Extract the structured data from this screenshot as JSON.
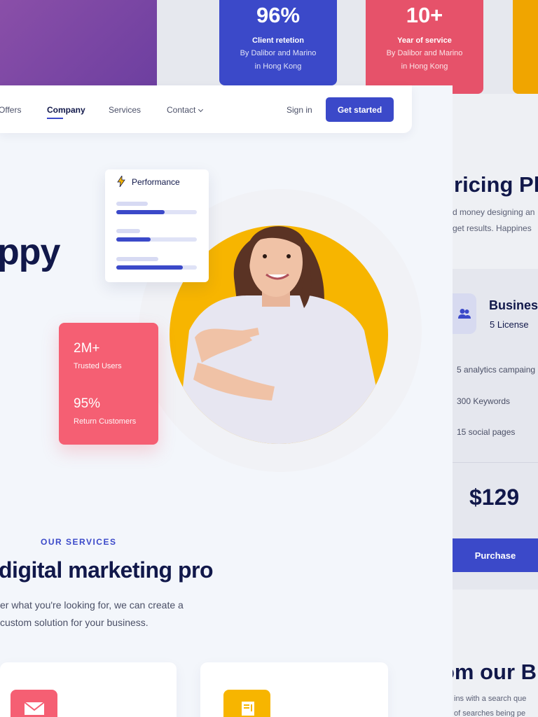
{
  "stats": [
    {
      "value": "96%",
      "title": "Client retetion",
      "sub1": "By Dalibor and Marino",
      "sub2": "in Hong Kong"
    },
    {
      "value": "10+",
      "title": "Year of service",
      "sub1": "By Dalibor and Marino",
      "sub2": "in Hong Kong"
    }
  ],
  "nav": {
    "items": [
      "Offers",
      "Company",
      "Services",
      "Contact"
    ],
    "active": "Company",
    "sign_in": "Sign in",
    "get_started": "Get started"
  },
  "hero": {
    "title_partial": "ppy"
  },
  "performance": {
    "title": "Performance",
    "bars": [
      0.6,
      0.43,
      0.83
    ]
  },
  "user_stats": [
    {
      "value": "2M+",
      "label": "Trusted Users"
    },
    {
      "value": "95%",
      "label": "Return Customers"
    }
  ],
  "services": {
    "tag": "OUR SERVICES",
    "title": "digital marketing pro",
    "desc1": "er what you're looking for, we can create a",
    "desc2": "custom solution for your business."
  },
  "pricing": {
    "title": "ricing Pla",
    "desc1": "d money designing an",
    "desc2": "get results. Happines",
    "plan": {
      "name": "Busines",
      "license": "5 License",
      "features": [
        "5 analytics campaing",
        "300 Keywords",
        "15 social pages"
      ],
      "price": "$129",
      "purchase": "Purchase"
    }
  },
  "blog": {
    "title": "om our B",
    "desc1": "ins with a search que",
    "desc2": "of searches being pe"
  },
  "colors": {
    "primary": "#3b49c9",
    "pink": "#f55f73",
    "yellow": "#f7b500",
    "navy": "#11184a",
    "purple": "#7c47a5"
  }
}
